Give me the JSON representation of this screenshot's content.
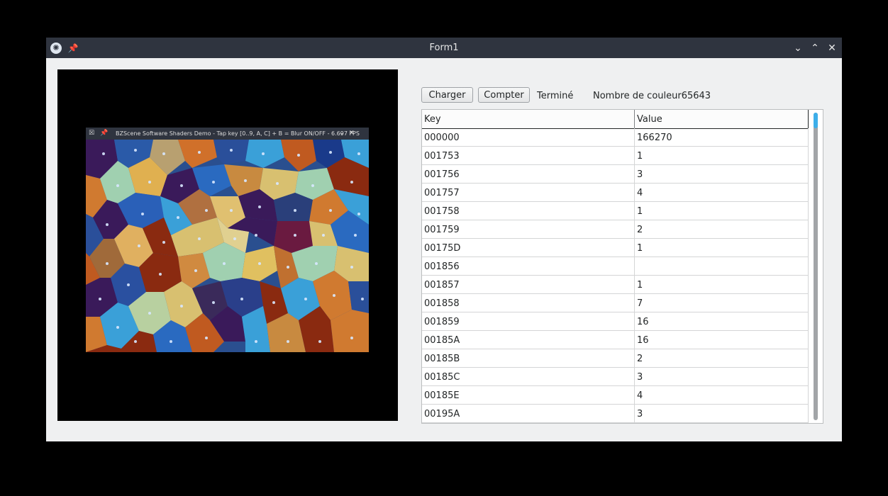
{
  "window": {
    "title": "Form1",
    "controls": {
      "minimize_icon": "chevron-down-icon",
      "maximize_icon": "chevron-up-icon",
      "close_icon": "close-icon"
    }
  },
  "embedded_window": {
    "title": "BZScene Software Shaders Demo - Tap key [0..9, A, C] + B = Blur ON/OFF - 6.697 FPS"
  },
  "toolbar": {
    "charger_label": "Charger",
    "compter_label": "Compter",
    "status_label": "Terminé",
    "colors_label": "Nombre de couleur65643"
  },
  "grid": {
    "columns": [
      "Key",
      "Value"
    ],
    "rows": [
      {
        "key": "000000",
        "value": "166270"
      },
      {
        "key": "001753",
        "value": "1"
      },
      {
        "key": "001756",
        "value": "3"
      },
      {
        "key": "001757",
        "value": "4"
      },
      {
        "key": "001758",
        "value": "1"
      },
      {
        "key": "001759",
        "value": "2"
      },
      {
        "key": "00175D",
        "value": "1"
      },
      {
        "key": "001856",
        "value": ""
      },
      {
        "key": "001857",
        "value": "1"
      },
      {
        "key": "001858",
        "value": "7"
      },
      {
        "key": "001859",
        "value": "16"
      },
      {
        "key": "00185A",
        "value": "16"
      },
      {
        "key": "00185B",
        "value": "2"
      },
      {
        "key": "00185C",
        "value": "3"
      },
      {
        "key": "00185E",
        "value": "4"
      },
      {
        "key": "00195A",
        "value": "3"
      }
    ]
  },
  "colors": {
    "titlebar": "#2f343f",
    "window_bg": "#eff0f1",
    "scroll_accent": "#3daee9"
  }
}
